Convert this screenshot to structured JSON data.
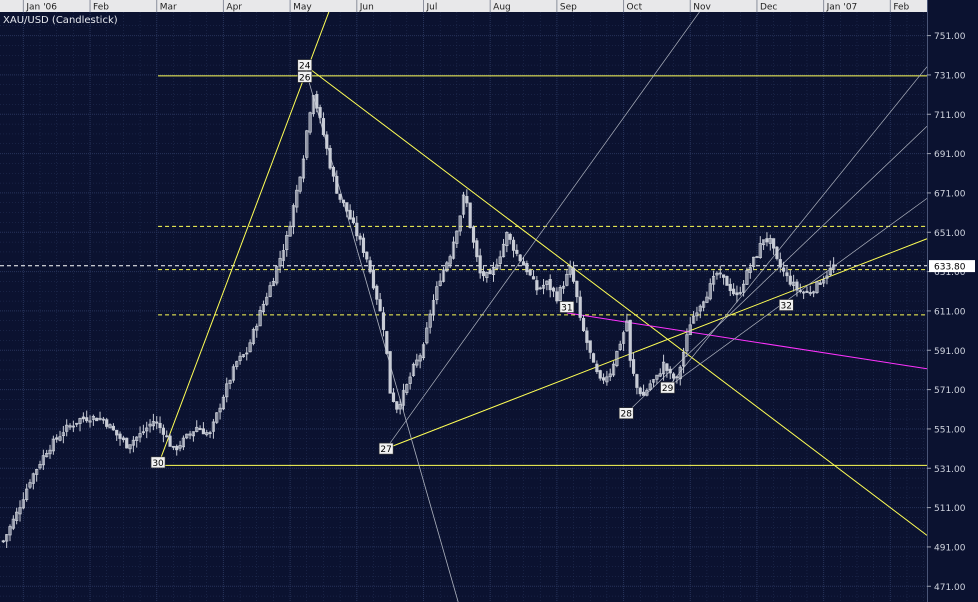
{
  "chart_data": {
    "type": "candlestick",
    "title": "XAU/USD (Candlestick)",
    "x_ticks": [
      "Jan '06",
      "Feb",
      "Mar",
      "Apr",
      "May",
      "Jun",
      "Jul",
      "Aug",
      "Sep",
      "Oct",
      "Nov",
      "Dec",
      "Jan '07",
      "Feb"
    ],
    "y_ticks": [
      751,
      731,
      711,
      691,
      671,
      651,
      631,
      611,
      591,
      571,
      551,
      531,
      511,
      491,
      471
    ],
    "y_tick_labels": [
      "751.00",
      "731.00",
      "711.00",
      "691.00",
      "671.00",
      "651.00",
      "631.00",
      "611.00",
      "591.00",
      "571.00",
      "551.00",
      "531.00",
      "511.00",
      "491.00",
      "471.00"
    ],
    "ylim": [
      463,
      763
    ],
    "xlim": [
      -0.35,
      13.55
    ],
    "grid": true,
    "last_price": 633.8,
    "last_price_label": "633.80",
    "colors": {
      "background": "#0b1230",
      "grid": "#27335a",
      "candle": "#c8ccd6",
      "yellow": "#ffff55",
      "magenta": "#ff33ff",
      "white": "#ffffff"
    },
    "close_anchors": [
      [
        -0.3,
        494
      ],
      [
        -0.1,
        508
      ],
      [
        0.1,
        525
      ],
      [
        0.35,
        540
      ],
      [
        0.6,
        550
      ],
      [
        0.85,
        556
      ],
      [
        1.0,
        557
      ],
      [
        1.2,
        556
      ],
      [
        1.4,
        548
      ],
      [
        1.55,
        543
      ],
      [
        1.75,
        548
      ],
      [
        1.95,
        555
      ],
      [
        2.1,
        550
      ],
      [
        2.25,
        540
      ],
      [
        2.4,
        545
      ],
      [
        2.6,
        552
      ],
      [
        2.8,
        548
      ],
      [
        3.0,
        568
      ],
      [
        3.2,
        585
      ],
      [
        3.35,
        590
      ],
      [
        3.55,
        610
      ],
      [
        3.75,
        628
      ],
      [
        3.95,
        648
      ],
      [
        4.1,
        672
      ],
      [
        4.2,
        690
      ],
      [
        4.28,
        710
      ],
      [
        4.35,
        722
      ],
      [
        4.42,
        712
      ],
      [
        4.52,
        698
      ],
      [
        4.62,
        682
      ],
      [
        4.72,
        670
      ],
      [
        4.85,
        662
      ],
      [
        5.0,
        650
      ],
      [
        5.15,
        638
      ],
      [
        5.3,
        618
      ],
      [
        5.42,
        600
      ],
      [
        5.5,
        570
      ],
      [
        5.6,
        562
      ],
      [
        5.72,
        570
      ],
      [
        5.85,
        582
      ],
      [
        6.0,
        592
      ],
      [
        6.1,
        610
      ],
      [
        6.25,
        628
      ],
      [
        6.4,
        640
      ],
      [
        6.55,
        660
      ],
      [
        6.62,
        672
      ],
      [
        6.72,
        650
      ],
      [
        6.85,
        630
      ],
      [
        7.0,
        628
      ],
      [
        7.15,
        640
      ],
      [
        7.25,
        650
      ],
      [
        7.4,
        640
      ],
      [
        7.55,
        632
      ],
      [
        7.7,
        622
      ],
      [
        7.85,
        625
      ],
      [
        8.0,
        618
      ],
      [
        8.1,
        625
      ],
      [
        8.2,
        632
      ],
      [
        8.28,
        622
      ],
      [
        8.35,
        606
      ],
      [
        8.45,
        595
      ],
      [
        8.55,
        583
      ],
      [
        8.65,
        575
      ],
      [
        8.8,
        580
      ],
      [
        8.9,
        590
      ],
      [
        9.0,
        600
      ],
      [
        9.05,
        606
      ],
      [
        9.1,
        585
      ],
      [
        9.2,
        572
      ],
      [
        9.3,
        568
      ],
      [
        9.4,
        574
      ],
      [
        9.5,
        577
      ],
      [
        9.6,
        584
      ],
      [
        9.7,
        578
      ],
      [
        9.8,
        576
      ],
      [
        9.9,
        590
      ],
      [
        10.0,
        605
      ],
      [
        10.1,
        612
      ],
      [
        10.25,
        620
      ],
      [
        10.4,
        630
      ],
      [
        10.55,
        625
      ],
      [
        10.7,
        618
      ],
      [
        10.85,
        630
      ],
      [
        11.0,
        640
      ],
      [
        11.1,
        648
      ],
      [
        11.2,
        646
      ],
      [
        11.3,
        636
      ],
      [
        11.45,
        628
      ],
      [
        11.6,
        622
      ],
      [
        11.75,
        620
      ],
      [
        11.9,
        624
      ],
      [
        12.05,
        630
      ],
      [
        12.15,
        633.8
      ]
    ],
    "markers": [
      {
        "label": "24",
        "x": 4.22,
        "y": 736
      },
      {
        "label": "26",
        "x": 4.22,
        "y": 730
      },
      {
        "label": "27",
        "x": 5.44,
        "y": 541
      },
      {
        "label": "28",
        "x": 9.04,
        "y": 559
      },
      {
        "label": "29",
        "x": 9.66,
        "y": 572
      },
      {
        "label": "30",
        "x": 2.02,
        "y": 534
      },
      {
        "label": "31",
        "x": 8.15,
        "y": 613
      },
      {
        "label": "32",
        "x": 11.44,
        "y": 614
      }
    ]
  }
}
